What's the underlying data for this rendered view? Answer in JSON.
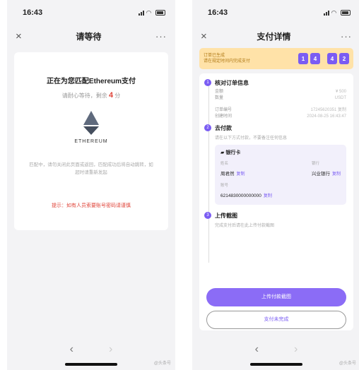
{
  "left": {
    "status_time": "16:43",
    "nav_title": "请等待",
    "close": "×",
    "more": "···",
    "heading": "正在为您匹配Ethereum支付",
    "countdown_prefix": "请耐心等待，剩余",
    "countdown_value": "4",
    "countdown_unit": "分",
    "coin_label": "ETHEREUM",
    "description": "匹配中，请勿关闭此页面或返回，匹配成功后将自动跳转，如超时请重新发起",
    "warning": "提示：如有人员索要账号密码请谨慎",
    "nav_back": "‹",
    "nav_forward": "›",
    "watermark": "@头条号"
  },
  "right": {
    "status_time": "16:43",
    "nav_title": "支付详情",
    "close": "×",
    "more": "···",
    "banner_line1": "订单已生成",
    "banner_line2": "请在规定时间内完成支付",
    "timer_digits": [
      "1",
      "4",
      "4",
      "2"
    ],
    "step1": {
      "num": "1",
      "title": "核对订单信息",
      "rows": [
        {
          "k": "金额",
          "v": "¥ 500"
        },
        {
          "k": "数量",
          "v": "USDT"
        },
        {
          "k": "订单编号",
          "v": "17245620351 复制"
        },
        {
          "k": "创建时间",
          "v": "2024-08-25 16:43:47"
        }
      ]
    },
    "step2": {
      "num": "2",
      "title": "去付款",
      "sub": "请在以下方式付款，不要备注任何信息",
      "bank_name": "银行卡",
      "name_k": "姓名",
      "name_v": "周君然",
      "bank_k": "银行",
      "bank_v": "兴业银行",
      "card_k": "账号",
      "card_v": "6214830000000000",
      "copy": "复制"
    },
    "step3": {
      "num": "3",
      "title": "上传截图",
      "sub": "完成支付后请在此上传付款截图"
    },
    "btn_upload": "上传付款截图",
    "btn_done": "支付未完成",
    "nav_back": "‹",
    "nav_forward": "›",
    "watermark": "@头条号"
  }
}
